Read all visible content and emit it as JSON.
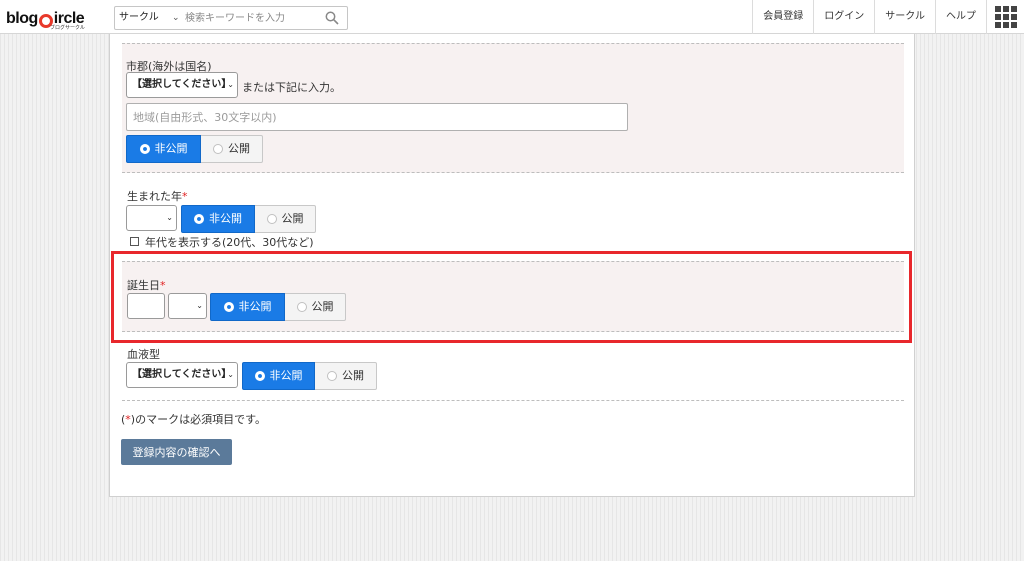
{
  "header": {
    "logo_text_1": "blog",
    "logo_text_2": "ircle",
    "logo_sub": "ブログサークル",
    "search_category": "サークル",
    "search_placeholder": "検索キーワードを入力",
    "nav": [
      "会員登録",
      "ログイン",
      "サークル",
      "ヘルプ"
    ]
  },
  "form": {
    "city": {
      "label": "市郡(海外は国名)",
      "select_value": "【選択してください】",
      "hint": "または下記に入力。",
      "input_placeholder": "地域(自由形式、30文字以内)",
      "private_label": "非公開",
      "public_label": "公開"
    },
    "birth_year": {
      "label": "生まれた年",
      "required_mark": "*",
      "private_label": "非公開",
      "public_label": "公開",
      "checkbox_label": "年代を表示する(20代、30代など)"
    },
    "birthday": {
      "label": "誕生日",
      "required_mark": "*",
      "private_label": "非公開",
      "public_label": "公開"
    },
    "blood_type": {
      "label": "血液型",
      "select_value": "【選択してください】",
      "private_label": "非公開",
      "public_label": "公開"
    },
    "required_note_open": "(",
    "required_note_mark": "*",
    "required_note_rest": ")のマークは必須項目です。",
    "submit_label": "登録内容の確認へ"
  },
  "colors": {
    "accent": "#1a7be6",
    "submit": "#5b7a9a",
    "highlight": "#e8272c",
    "section_bg": "#f7f1f1"
  }
}
